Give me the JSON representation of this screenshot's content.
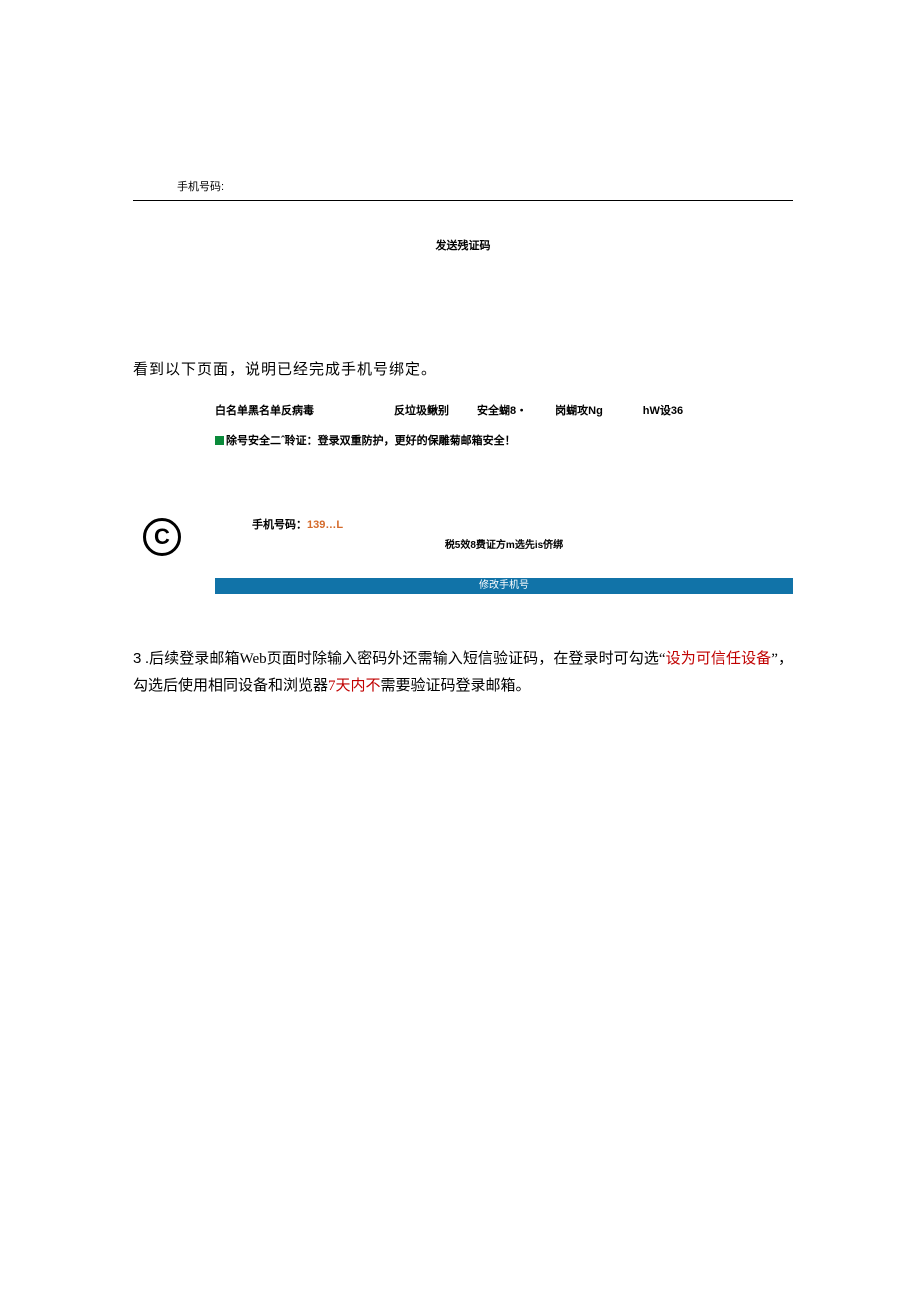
{
  "top": {
    "phone_label": "手机号码:",
    "send_code": "发送残证码"
  },
  "para1": "看到以下页面，说明已经完成手机号绑定。",
  "tabs": {
    "t1": "白名单黑名单反病毒",
    "t2": "反垃圾鳅别",
    "t3": "安全蝴8・",
    "t4": "岗蝴攻Ng",
    "t5": "hW设36"
  },
  "green_line": "除号安全二ˆ聆证：登录双重防护，更好的保雕菊邮箱安全！",
  "copyright": "C",
  "bound": {
    "label": "手机号码：",
    "num": "139…L"
  },
  "small_note": "税5效8费证方m选先is侪绑",
  "blue_bar": "修改手机号",
  "para3": {
    "num": "3",
    "dot": " .",
    "seg1": "后续登录邮箱Web页面时除输入密码外还需输入短信验证码，在登录时可勾选“",
    "red1": "设为可信任设备",
    "seg2": "”，勾选后使用相同设备和浏览器",
    "red2": "7天内不",
    "seg3": "需要验证码登录邮箱。"
  }
}
